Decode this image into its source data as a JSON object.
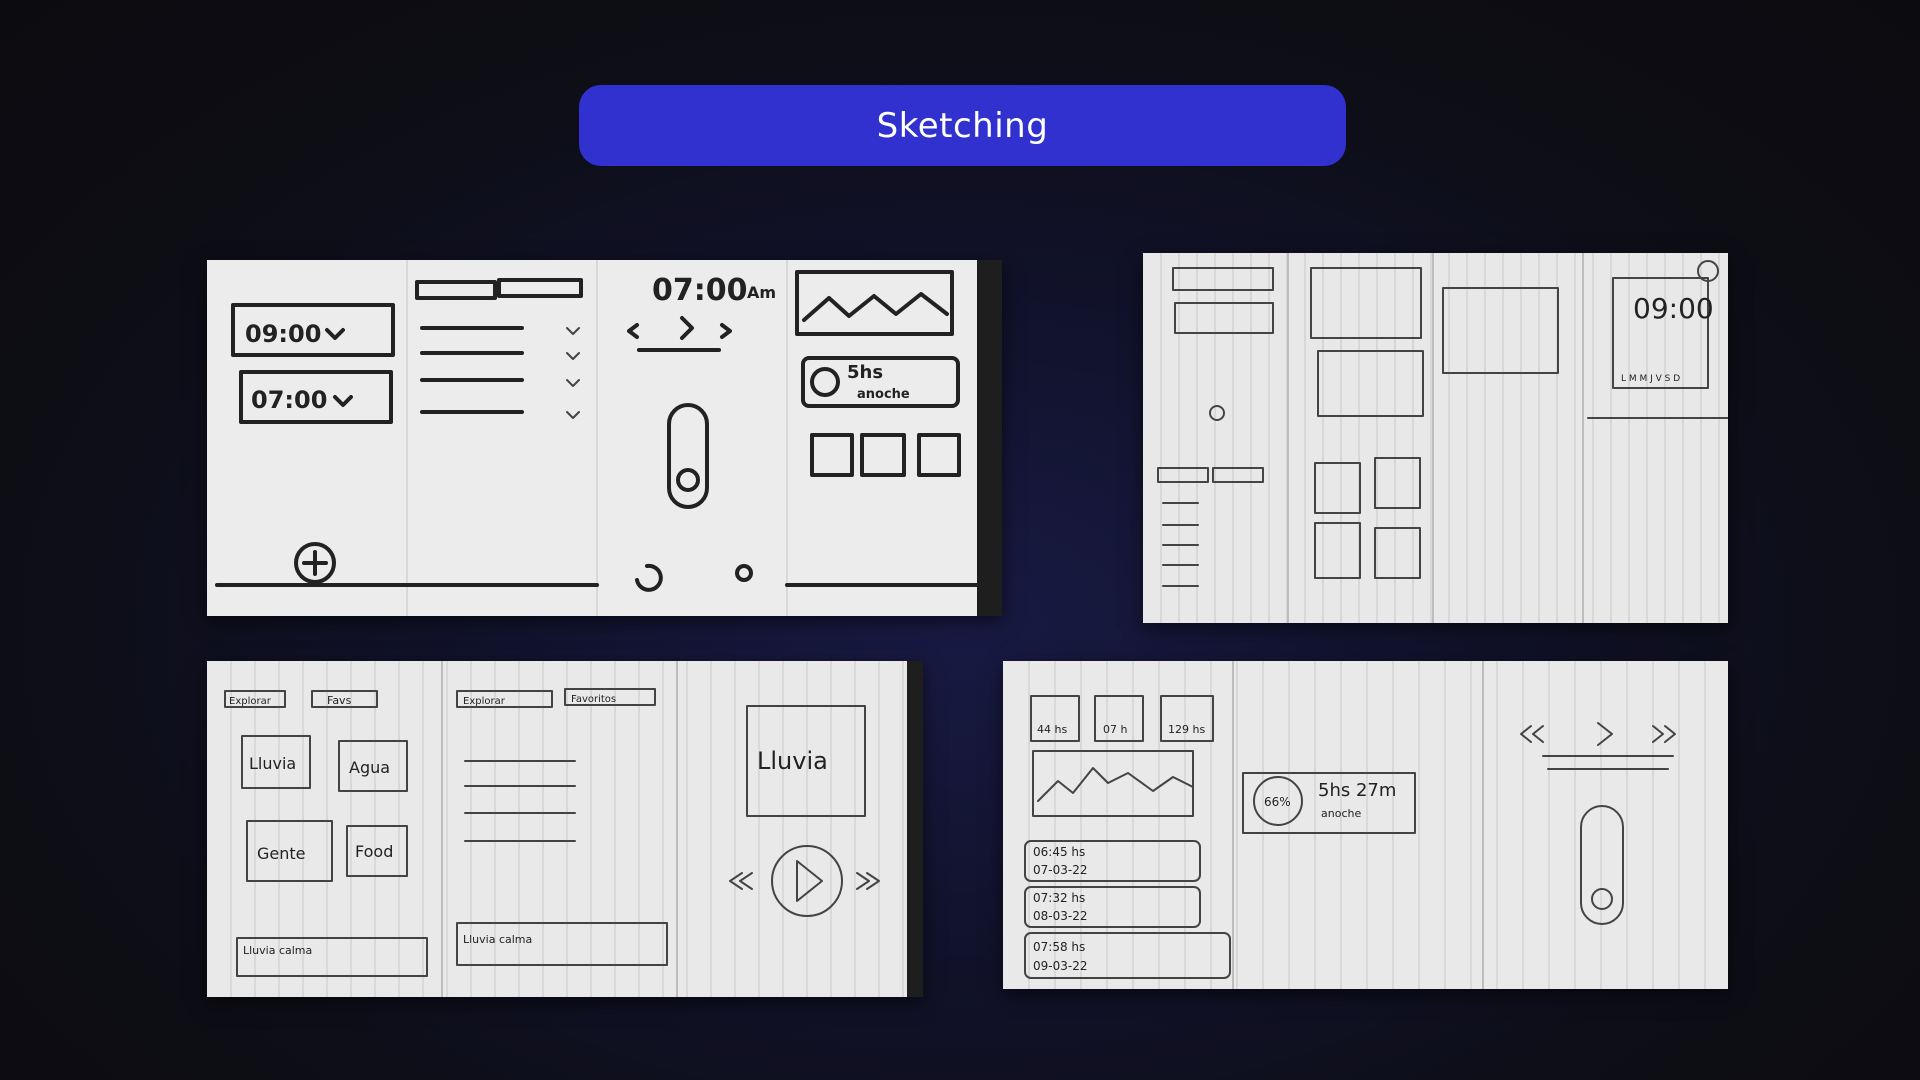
{
  "header": {
    "title": "Sketching",
    "pill_color": "#3131cf"
  },
  "sketches": {
    "s1": {
      "alarm_1": "09:00",
      "alarm_2": "07:00",
      "clock": "07:00",
      "clock_suffix": "Am",
      "sleep": "5hs",
      "sleep_sub": "anoche"
    },
    "s2": {
      "clock": "09:00",
      "weekdays": "L M M J V S D"
    },
    "s3": {
      "tab_1": "Explorar",
      "tab_2": "Favs",
      "tab_3": "Explorar",
      "tab_4": "Favoritos",
      "card_1": "Lluvia",
      "card_2": "Agua",
      "card_3": "Gente",
      "card_4": "Food",
      "now_playing": "Lluvia",
      "player_1": "Lluvia calma",
      "player_2": "Lluvia calma"
    },
    "s4": {
      "stat_1": "44 hs",
      "stat_2": "07 h",
      "stat_3": "129 hs",
      "sleep": "5hs 27m",
      "sleep_sub": "anoche",
      "percent": "66%",
      "row_1_time": "06:45 hs",
      "row_1_date": "07-03-22",
      "row_2_time": "07:32 hs",
      "row_2_date": "08-03-22",
      "row_3_time": "07:58 hs",
      "row_3_date": "09-03-22"
    }
  }
}
